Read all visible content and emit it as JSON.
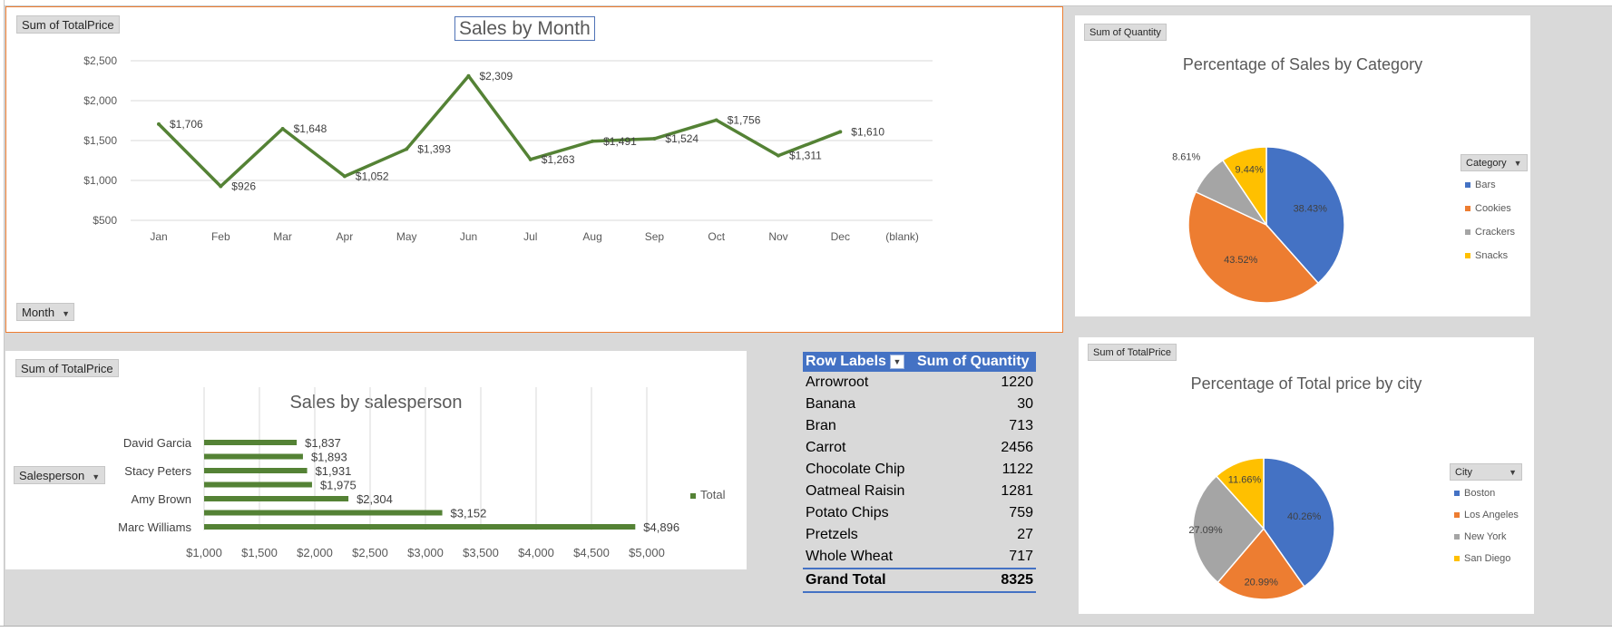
{
  "colors": {
    "line": "#548235",
    "bar": "#548235",
    "blue": "#4472c4",
    "orange": "#ed7d31",
    "gray": "#a5a5a5",
    "yellow": "#ffc000"
  },
  "month_chart": {
    "field_button": "Sum of TotalPrice",
    "axis_button": "Month",
    "chart_data": {
      "type": "line",
      "title": "Sales by Month",
      "categories": [
        "Jan",
        "Feb",
        "Mar",
        "Apr",
        "May",
        "Jun",
        "Jul",
        "Aug",
        "Sep",
        "Oct",
        "Nov",
        "Dec",
        "(blank)"
      ],
      "values": [
        1706,
        926,
        1648,
        1052,
        1393,
        2309,
        1263,
        1491,
        1524,
        1756,
        1311,
        1610,
        null
      ],
      "labels": [
        "$1,706",
        "$926",
        "$1,648",
        "$1,052",
        "$1,393",
        "$2,309",
        "$1,263",
        "$1,491",
        "$1,524",
        "$1,756",
        "$1,311",
        "$1,610"
      ],
      "yticks": [
        "$500",
        "$1,000",
        "$1,500",
        "$2,000",
        "$2,500"
      ],
      "ytick_values": [
        500,
        1000,
        1500,
        2000,
        2500
      ],
      "ylim": [
        500,
        2500
      ],
      "grid": true
    }
  },
  "category_chart": {
    "field_button": "Sum of Quantity",
    "legend_button": "Category",
    "chart_data": {
      "type": "pie",
      "title": "Percentage of Sales by Category",
      "categories": [
        "Bars",
        "Cookies",
        "Crackers",
        "Snacks"
      ],
      "values": [
        38.43,
        43.52,
        8.61,
        9.44
      ],
      "labels": [
        "38.43%",
        "43.52%",
        "8.61%",
        "9.44%"
      ],
      "legend": "right"
    }
  },
  "salesperson_chart": {
    "field_button": "Sum of TotalPrice",
    "axis_button": "Salesperson",
    "chart_data": {
      "type": "bar",
      "title": "Sales by salesperson",
      "categories": [
        "David Garcia",
        "",
        "Stacy Peters",
        "",
        "Amy Brown",
        "",
        "Marc Williams"
      ],
      "values": [
        1837,
        1893,
        1931,
        1975,
        2304,
        3152,
        4896
      ],
      "labels": [
        "$1,837",
        "$1,893",
        "$1,931",
        "$1,975",
        "$2,304",
        "$3,152",
        "$4,896"
      ],
      "xticks": [
        "$1,000",
        "$1,500",
        "$2,000",
        "$2,500",
        "$3,000",
        "$3,500",
        "$4,000",
        "$4,500",
        "$5,000"
      ],
      "xtick_values": [
        1000,
        1500,
        2000,
        2500,
        3000,
        3500,
        4000,
        4500,
        5000
      ],
      "xlim": [
        1000,
        5000
      ],
      "legend_label": "Total",
      "legend": "right",
      "grid": true
    }
  },
  "pivot_table": {
    "headers": [
      "Row Labels",
      "Sum of Quantity"
    ],
    "rows": [
      [
        "Arrowroot",
        "1220"
      ],
      [
        "Banana",
        "30"
      ],
      [
        "Bran",
        "713"
      ],
      [
        "Carrot",
        "2456"
      ],
      [
        "Chocolate Chip",
        "1122"
      ],
      [
        "Oatmeal Raisin",
        "1281"
      ],
      [
        "Potato Chips",
        "759"
      ],
      [
        "Pretzels",
        "27"
      ],
      [
        "Whole Wheat",
        "717"
      ]
    ],
    "grand_total": [
      "Grand Total",
      "8325"
    ]
  },
  "city_chart": {
    "field_button": "Sum of TotalPrice",
    "legend_button": "City",
    "chart_data": {
      "type": "pie",
      "title": "Percentage of Total price by city",
      "categories": [
        "Boston",
        "Los Angeles",
        "New York",
        "San Diego"
      ],
      "values": [
        40.26,
        20.99,
        27.09,
        11.66
      ],
      "labels": [
        "40.26%",
        "20.99%",
        "27.09%",
        "11.66%"
      ],
      "legend": "right"
    }
  }
}
